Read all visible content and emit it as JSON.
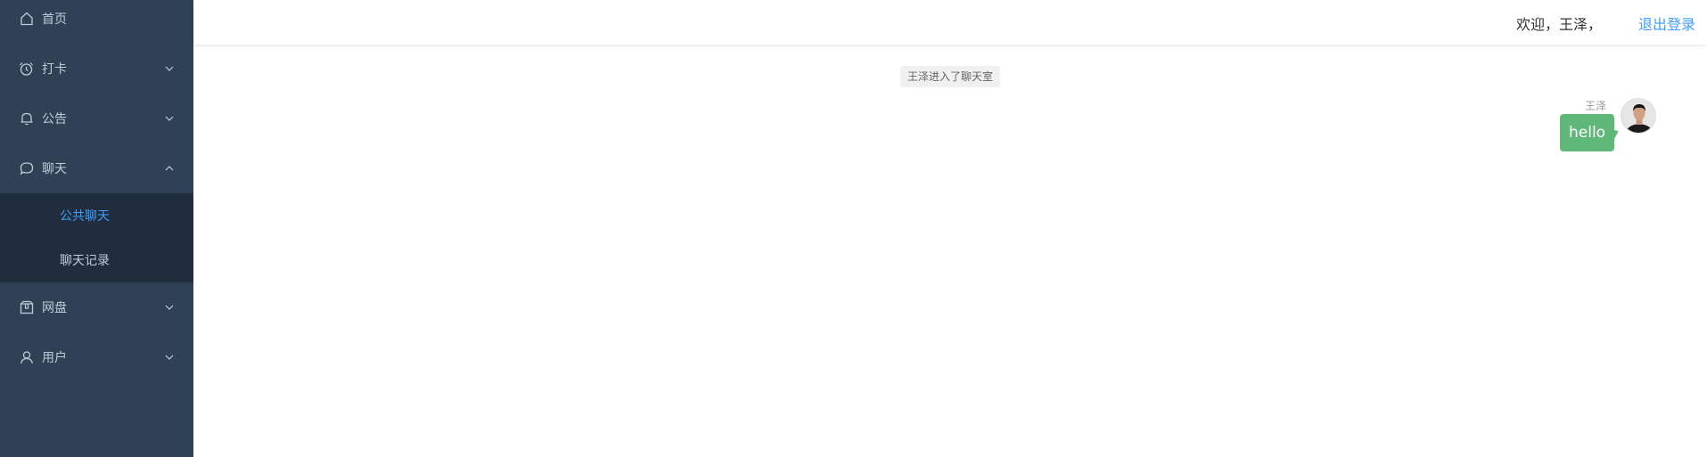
{
  "sidebar": {
    "items": [
      {
        "label": "首页",
        "icon": "home-icon"
      },
      {
        "label": "打卡",
        "icon": "alarm-clock-icon"
      },
      {
        "label": "公告",
        "icon": "bell-icon"
      },
      {
        "label": "聊天",
        "icon": "chat-bubble-icon"
      },
      {
        "label": "网盘",
        "icon": "package-icon"
      },
      {
        "label": "用户",
        "icon": "user-icon"
      }
    ],
    "chat_sub": [
      {
        "label": "公共聊天",
        "active": true
      },
      {
        "label": "聊天记录",
        "active": false
      }
    ],
    "colors": {
      "bg": "#304156",
      "text": "#bfcbd9",
      "active": "#409eff",
      "sub_bg": "#1f2d3d"
    }
  },
  "header": {
    "welcome": "欢迎，王泽，",
    "logout": "退出登录"
  },
  "chat": {
    "system_message": "王泽进入了聊天室",
    "messages": [
      {
        "sender": "王泽",
        "text": "hello",
        "bubble_color": "#5fb878"
      }
    ]
  }
}
